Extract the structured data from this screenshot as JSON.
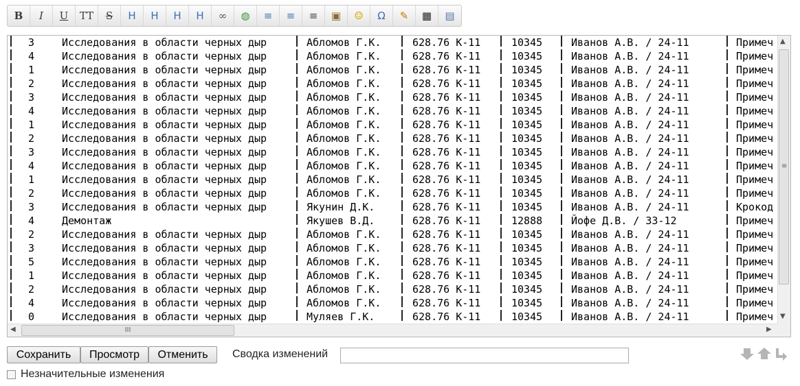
{
  "toolbar": {
    "buttons": [
      {
        "name": "bold-icon",
        "glyph": "B"
      },
      {
        "name": "italic-icon",
        "glyph": "I"
      },
      {
        "name": "underline-icon",
        "glyph": "U"
      },
      {
        "name": "small-caps-icon",
        "glyph": "TT"
      },
      {
        "name": "strikethrough-icon",
        "glyph": "S"
      },
      {
        "name": "heading-1-icon",
        "glyph": "H"
      },
      {
        "name": "heading-2-icon",
        "glyph": "H"
      },
      {
        "name": "heading-3-icon",
        "glyph": "H"
      },
      {
        "name": "heading-4-icon",
        "glyph": "H"
      },
      {
        "name": "link-icon",
        "glyph": "∞"
      },
      {
        "name": "globe-link-icon",
        "glyph": "◍"
      },
      {
        "name": "numbered-list-icon",
        "glyph": "≡"
      },
      {
        "name": "bulleted-list-icon",
        "glyph": "≡"
      },
      {
        "name": "indent-icon",
        "glyph": "≡"
      },
      {
        "name": "image-icon",
        "glyph": "▣"
      },
      {
        "name": "smiley-icon",
        "glyph": "☺"
      },
      {
        "name": "omega-icon",
        "glyph": "Ω"
      },
      {
        "name": "signature-icon",
        "glyph": "✎"
      },
      {
        "name": "table-icon",
        "glyph": "▦"
      },
      {
        "name": "template-icon",
        "glyph": "▤"
      }
    ]
  },
  "editor": {
    "rows": [
      {
        "num": "3",
        "title": "Исследования в области черных дыр",
        "author": "Абломов Г.К.",
        "code": "628.76 К-11",
        "id": "10345",
        "resp": "Иванов А.В. / 24-11",
        "note": "Примеч"
      },
      {
        "num": "4",
        "title": "Исследования в области черных дыр",
        "author": "Абломов Г.К.",
        "code": "628.76 К-11",
        "id": "10345",
        "resp": "Иванов А.В. / 24-11",
        "note": "Примеч"
      },
      {
        "num": "1",
        "title": "Исследования в области черных дыр",
        "author": "Абломов Г.К.",
        "code": "628.76 К-11",
        "id": "10345",
        "resp": "Иванов А.В. / 24-11",
        "note": "Примеч"
      },
      {
        "num": "2",
        "title": "Исследования в области черных дыр",
        "author": "Абломов Г.К.",
        "code": "628.76 К-11",
        "id": "10345",
        "resp": "Иванов А.В. / 24-11",
        "note": "Примеч"
      },
      {
        "num": "3",
        "title": "Исследования в области черных дыр",
        "author": "Абломов Г.К.",
        "code": "628.76 К-11",
        "id": "10345",
        "resp": "Иванов А.В. / 24-11",
        "note": "Примеч"
      },
      {
        "num": "4",
        "title": "Исследования в области черных дыр",
        "author": "Абломов Г.К.",
        "code": "628.76 К-11",
        "id": "10345",
        "resp": "Иванов А.В. / 24-11",
        "note": "Примеч"
      },
      {
        "num": "1",
        "title": "Исследования в области черных дыр",
        "author": "Абломов Г.К.",
        "code": "628.76 К-11",
        "id": "10345",
        "resp": "Иванов А.В. / 24-11",
        "note": "Примеч"
      },
      {
        "num": "2",
        "title": "Исследования в области черных дыр",
        "author": "Абломов Г.К.",
        "code": "628.76 К-11",
        "id": "10345",
        "resp": "Иванов А.В. / 24-11",
        "note": "Примеч"
      },
      {
        "num": "3",
        "title": "Исследования в области черных дыр",
        "author": "Абломов Г.К.",
        "code": "628.76 К-11",
        "id": "10345",
        "resp": "Иванов А.В. / 24-11",
        "note": "Примеч"
      },
      {
        "num": "4",
        "title": "Исследования в области черных дыр",
        "author": "Абломов Г.К.",
        "code": "628.76 К-11",
        "id": "10345",
        "resp": "Иванов А.В. / 24-11",
        "note": "Примеч"
      },
      {
        "num": "1",
        "title": "Исследования в области черных дыр",
        "author": "Абломов Г.К.",
        "code": "628.76 К-11",
        "id": "10345",
        "resp": "Иванов А.В. / 24-11",
        "note": "Примеч"
      },
      {
        "num": "2",
        "title": "Исследования в области черных дыр",
        "author": "Абломов Г.К.",
        "code": "628.76 К-11",
        "id": "10345",
        "resp": "Иванов А.В. / 24-11",
        "note": "Примеч"
      },
      {
        "num": "3",
        "title": "Исследования в области черных дыр",
        "author": "Якунин Д.К.",
        "code": "628.76 К-11",
        "id": "10345",
        "resp": "Иванов А.В. / 24-11",
        "note": "Крокод"
      },
      {
        "num": "4",
        "title": "Демонтаж",
        "author": "Якушев В.Д.",
        "code": "628.76 К-11",
        "id": "12888",
        "resp": "Йофе Д.В. / 33-12",
        "note": "Примеч"
      },
      {
        "num": "2",
        "title": "Исследования в области черных дыр",
        "author": "Абломов Г.К.",
        "code": "628.76 К-11",
        "id": "10345",
        "resp": "Иванов А.В. / 24-11",
        "note": "Примеч"
      },
      {
        "num": "3",
        "title": "Исследования в области черных дыр",
        "author": "Абломов Г.К.",
        "code": "628.76 К-11",
        "id": "10345",
        "resp": "Иванов А.В. / 24-11",
        "note": "Примеч"
      },
      {
        "num": "5",
        "title": "Исследования в области черных дыр",
        "author": "Абломов Г.К.",
        "code": "628.76 К-11",
        "id": "10345",
        "resp": "Иванов А.В. / 24-11",
        "note": "Примеч"
      },
      {
        "num": "1",
        "title": "Исследования в области черных дыр",
        "author": "Абломов Г.К.",
        "code": "628.76 К-11",
        "id": "10345",
        "resp": "Иванов А.В. / 24-11",
        "note": "Примеч"
      },
      {
        "num": "2",
        "title": "Исследования в области черных дыр",
        "author": "Абломов Г.К.",
        "code": "628.76 К-11",
        "id": "10345",
        "resp": "Иванов А.В. / 24-11",
        "note": "Примеч"
      },
      {
        "num": "4",
        "title": "Исследования в области черных дыр",
        "author": "Абломов Г.К.",
        "code": "628.76 К-11",
        "id": "10345",
        "resp": "Иванов А.В. / 24-11",
        "note": "Примеч"
      },
      {
        "num": "0",
        "title": "Исследования в области черных дыр",
        "author": "Муляев Г.К.",
        "code": "628.76 К-11",
        "id": "10345",
        "resp": "Иванов А.В. / 24-11",
        "note": "Примеч"
      }
    ]
  },
  "actions": {
    "save_label": "Сохранить",
    "preview_label": "Просмотр",
    "cancel_label": "Отменить",
    "summary_label": "Сводка изменений",
    "summary_value": "",
    "minor_label": "Незначительные изменения"
  }
}
